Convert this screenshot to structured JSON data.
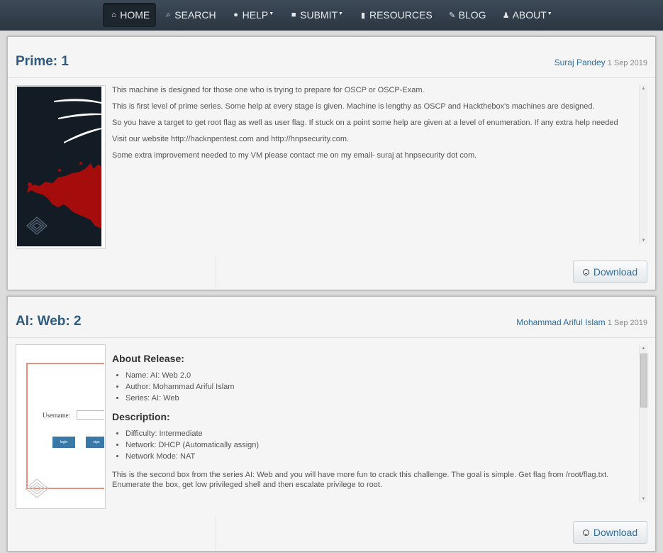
{
  "nav": {
    "items": [
      {
        "label": "HOME",
        "icon": "home-icon",
        "glyph": "⌂",
        "active": true,
        "dropdown": false
      },
      {
        "label": "SEARCH",
        "icon": "search-icon",
        "glyph": "⌕",
        "active": false,
        "dropdown": false
      },
      {
        "label": "HELP",
        "icon": "help-icon",
        "glyph": "❓",
        "active": false,
        "dropdown": true
      },
      {
        "label": "SUBMIT",
        "icon": "lock-icon",
        "glyph": "🔒",
        "active": false,
        "dropdown": true
      },
      {
        "label": "RESOURCES",
        "icon": "file-icon",
        "glyph": "▆",
        "active": false,
        "dropdown": false
      },
      {
        "label": "BLOG",
        "icon": "edit-icon",
        "glyph": "✎",
        "active": false,
        "dropdown": false
      },
      {
        "label": "ABOUT",
        "icon": "user-icon",
        "glyph": "👤",
        "active": false,
        "dropdown": true
      }
    ]
  },
  "entries": [
    {
      "title": "Prime: 1",
      "author": "Suraj Pandey",
      "date": "1 Sep 2019",
      "paragraphs": [
        "This machine is designed for those one who is trying to prepare for OSCP or OSCP-Exam.",
        "This is first level of prime series. Some help at every stage is given. Machine is lengthy as OSCP and Hackthebox's machines are designed.",
        "So you have a target to get root flag as well as user flag. If stuck on a point some help are given at a level of enumeration. If any extra help needed",
        "Visit our website http://hacknpentest.com and http://hnpsecurity.com.",
        "Some extra improvement needed to my VM please contact me on my email- suraj at hnpsecurity dot com."
      ],
      "download_label": "Download"
    },
    {
      "title": "AI: Web: 2",
      "author": "Mohammad Ariful Islam",
      "date": "1 Sep 2019",
      "thumb": {
        "username_label": "Username:",
        "login_label": "login",
        "signup_label": "sign"
      },
      "about_heading": "About Release:",
      "about_items": [
        "Name: AI: Web 2.0",
        "Author: Mohammad Ariful Islam",
        "Series: AI: Web"
      ],
      "desc_heading": "Description:",
      "desc_items": [
        "Difficulty: Intermediate",
        "Network: DHCP (Automatically assign)",
        "Network Mode: NAT"
      ],
      "paragraph": "This is the second box from the series AI: Web and you will have more fun to crack this challenge. The goal is simple. Get flag from /root/flag.txt. Enumerate the box, get low privileged shell and then escalate privilege to root.",
      "download_label": "Download"
    }
  ],
  "colors": {
    "nav_bg": "#35424f",
    "title": "#2f5a7e",
    "link": "#2f6ea0",
    "blood": "#a50d0d"
  }
}
